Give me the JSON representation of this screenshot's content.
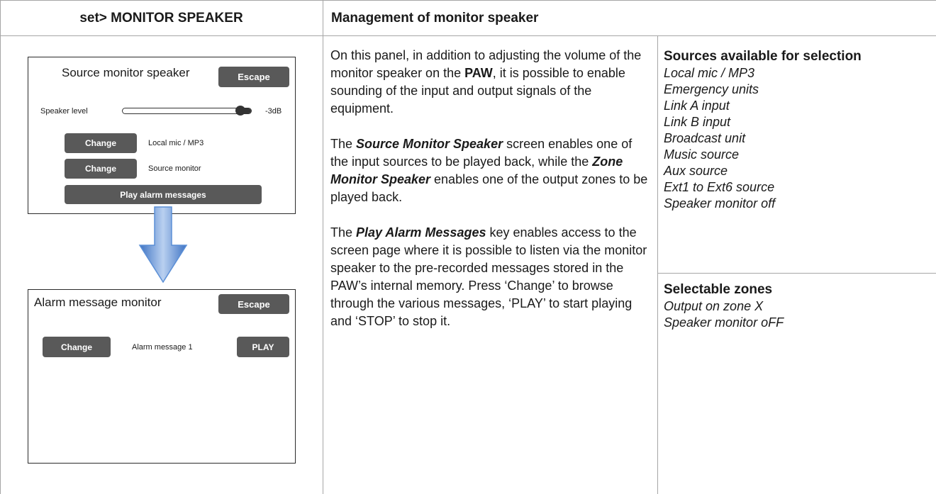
{
  "header": {
    "left": "set> MONITOR SPEAKER",
    "right": "Management of monitor speaker"
  },
  "panel1": {
    "title": "Source monitor speaker",
    "escape": "Escape",
    "speaker_label": "Speaker level",
    "level_value": "-3dB",
    "level_fraction": 0.95,
    "change1": "Change",
    "change1_value": "Local mic / MP3",
    "change2": "Change",
    "change2_value": "Source monitor",
    "play_alarm": "Play alarm messages"
  },
  "panel2": {
    "title": "Alarm message monitor",
    "escape": "Escape",
    "change": "Change",
    "message": "Alarm message 1",
    "play": "PLAY"
  },
  "description": {
    "p1_a": "On this panel, in addition to adjusting the volume of the monitor speaker on the ",
    "p1_bold": "PAW",
    "p1_b": ", it is possible to enable sounding of the input and output signals of the equipment.",
    "p2_a": "The ",
    "p2_bi1": "Source Monitor Speaker",
    "p2_b": " screen enables one of the input sources to be played back, while the ",
    "p2_bi2": "Zone Monitor Speaker",
    "p2_c": " enables one of the output zones to be played back.",
    "p3_a": "The ",
    "p3_bi": "Play Alarm Messages",
    "p3_b": " key enables access to the screen page where it is possible to listen via the monitor speaker to the pre-recorded messages stored in the PAW’s internal memory. Press ‘Change’ to browse through the various messages, ‘PLAY’ to start playing and ‘STOP’ to stop it."
  },
  "sources": {
    "title": "Sources available for selection",
    "items": [
      "Local mic / MP3",
      "Emergency units",
      "Link A input",
      "Link B input",
      "Broadcast unit",
      "Music source",
      "Aux source",
      "Ext1 to Ext6 source",
      "Speaker monitor off"
    ]
  },
  "zones": {
    "title": "Selectable zones",
    "items": [
      "Output on zone X",
      "Speaker monitor oFF"
    ]
  },
  "colors": {
    "button": "#595959",
    "arrow": "#5b8fd6",
    "border": "#a6a6a6"
  }
}
